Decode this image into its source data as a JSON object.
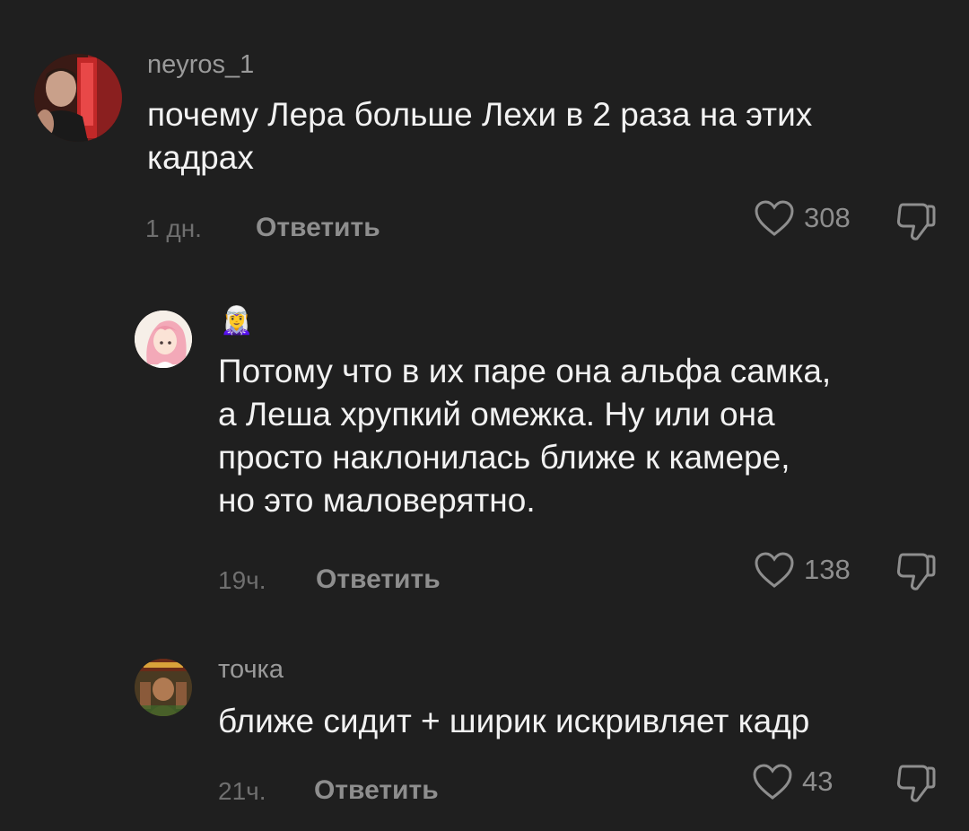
{
  "comments": [
    {
      "username": "neyros_1",
      "text_lines": [
        "почему Лера больше Лехи в 2 раза на этих",
        "кадрах"
      ],
      "time": "1 дн.",
      "reply_label": "Ответить",
      "likes": "308",
      "avatar_icon": "user-photo-avatar"
    },
    {
      "username": "🧝‍♀️",
      "text_lines": [
        "Потому что в их паре она альфа самка,",
        "а Леша хрупкий омежка. Ну или она",
        "просто наклонилась ближе к камере,",
        "но это маловерятно."
      ],
      "time": "19ч.",
      "reply_label": "Ответить",
      "likes": "138",
      "avatar_icon": "anime-girl-avatar"
    },
    {
      "username": "точка",
      "text_lines": [
        "ближе сидит + ширик искривляет кадр"
      ],
      "time": "21ч.",
      "reply_label": "Ответить",
      "likes": "43",
      "avatar_icon": "game-cover-avatar"
    }
  ],
  "icons": {
    "like": "heart-outline-icon",
    "dislike": "thumbs-down-icon"
  },
  "colors": {
    "background": "#1f1f1f",
    "text": "#f2f2f2",
    "muted": "#8e8e8e"
  }
}
